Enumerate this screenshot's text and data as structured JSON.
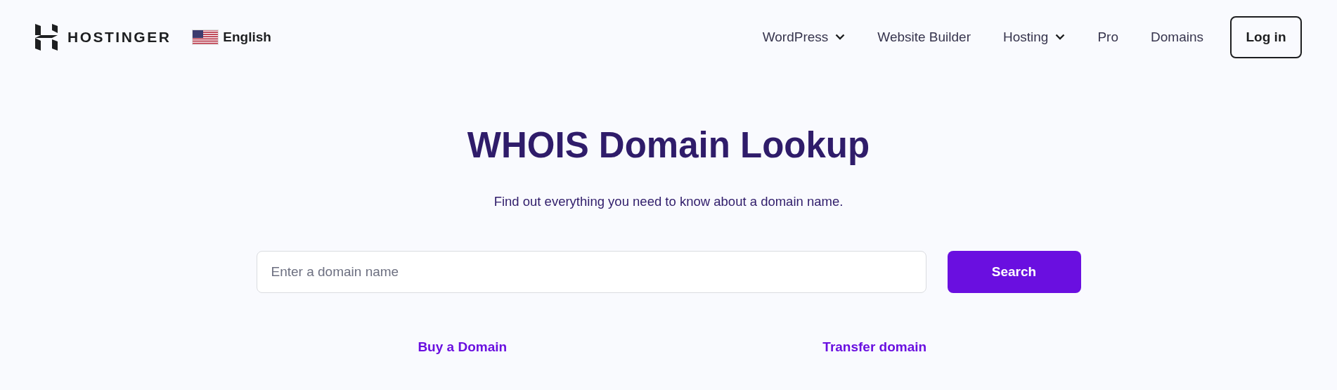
{
  "header": {
    "logo": "HOSTINGER",
    "language": "English",
    "nav": [
      {
        "label": "WordPress",
        "kind": "dropdown"
      },
      {
        "label": "Website Builder",
        "kind": "link"
      },
      {
        "label": "Hosting",
        "kind": "dropdown"
      },
      {
        "label": "Pro",
        "kind": "link"
      },
      {
        "label": "Domains",
        "kind": "link"
      }
    ],
    "login": "Log in"
  },
  "hero": {
    "title": "WHOIS Domain Lookup",
    "subtitle": "Find out everything you need to know about a domain name.",
    "search": {
      "placeholder": "Enter a domain name",
      "button": "Search"
    },
    "links": [
      "Buy a Domain",
      "Transfer domain"
    ]
  }
}
